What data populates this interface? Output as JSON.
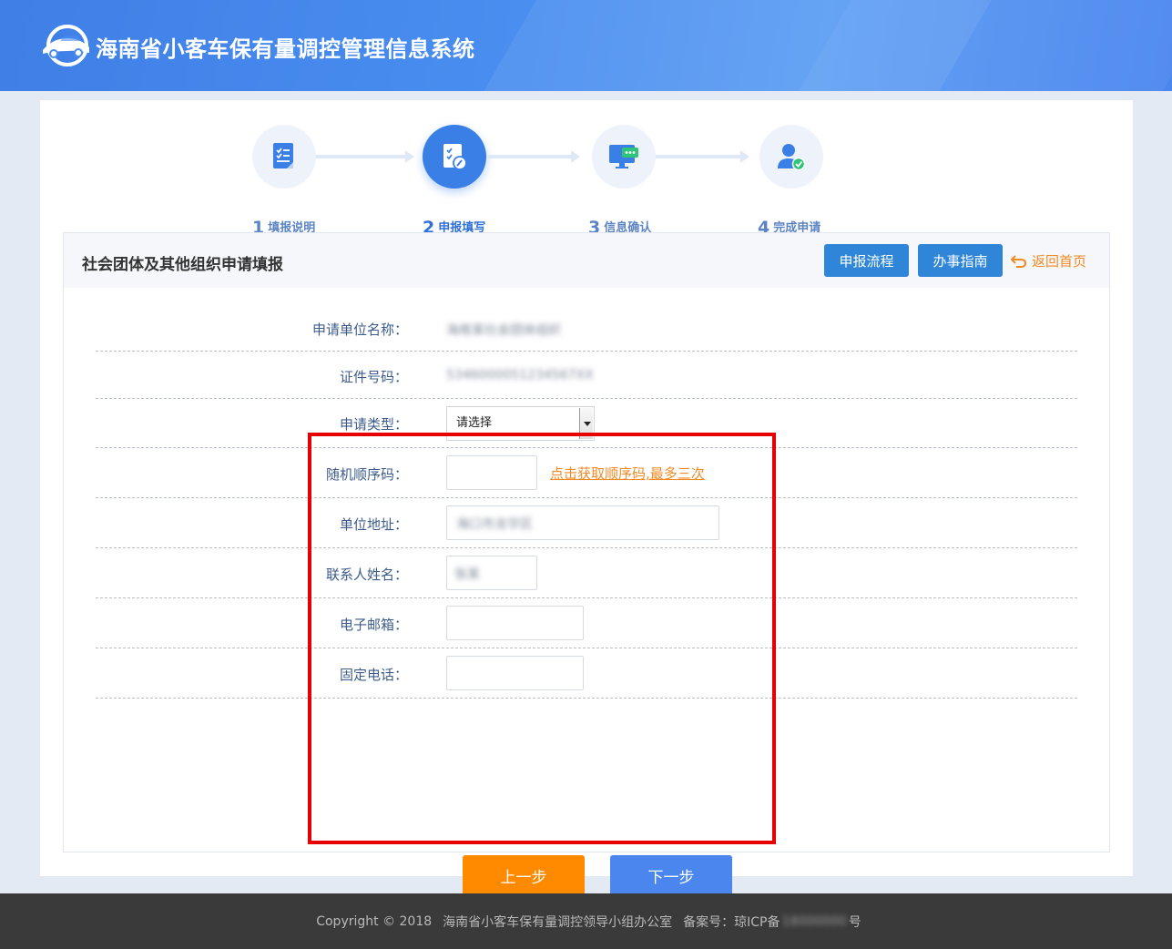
{
  "header": {
    "title": "海南省小客车保有量调控管理信息系统"
  },
  "steps": [
    {
      "num": "1",
      "label": "填报说明"
    },
    {
      "num": "2",
      "label": "申报填写"
    },
    {
      "num": "3",
      "label": "信息确认"
    },
    {
      "num": "4",
      "label": "完成申请"
    }
  ],
  "panel": {
    "title": "社会团体及其他组织申请填报",
    "flow_btn": "申报流程",
    "guide_btn": "办事指南",
    "back_link": "返回首页"
  },
  "form": {
    "org_name_label": "申请单位名称：",
    "org_name_value": "海南某社会团体组织",
    "cert_label": "证件号码：",
    "cert_value": "5346000051234567XX",
    "type_label": "申请类型：",
    "type_value": "请选择",
    "random_label": "随机顺序码：",
    "random_value": "",
    "random_link": "点击获取顺序码,最多三次",
    "address_label": "单位地址：",
    "address_value": "海口市龙华区",
    "contact_label": "联系人姓名：",
    "contact_value": "张某",
    "email_label": "电子邮箱：",
    "email_value": "",
    "phone_label": "固定电话：",
    "phone_value": ""
  },
  "actions": {
    "prev": "上一步",
    "next": "下一步"
  },
  "footer": {
    "copyright": "Copyright  © 2018",
    "org": "海南省小客车保有量调控领导小组办公室",
    "icp_label": "备案号：琼ICP备",
    "icp_num": "18000000",
    "icp_suffix": "号"
  },
  "colors": {
    "header_blue": "#4a8ef0",
    "button_blue": "#2f86d9",
    "orange": "#ff8a00",
    "frame_red": "#e60000"
  }
}
